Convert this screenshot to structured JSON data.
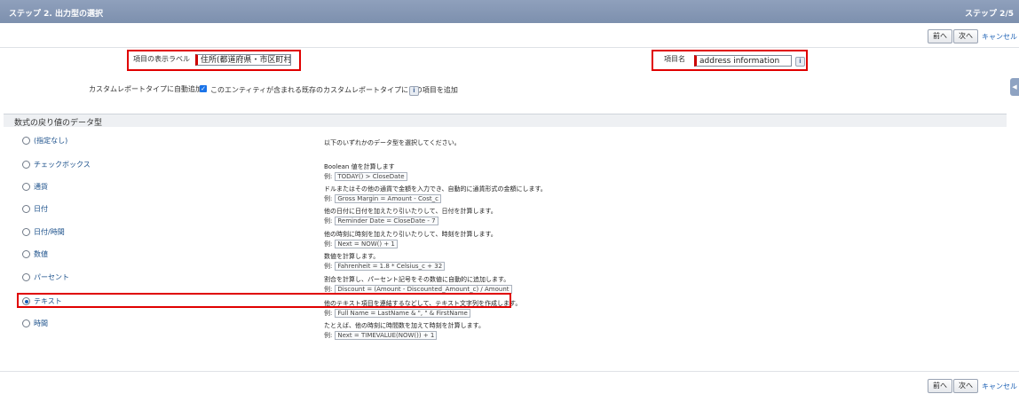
{
  "header": {
    "title": "ステップ 2. 出力型の選択",
    "step": "ステップ 2/5"
  },
  "nav": {
    "prev": "前へ",
    "next": "次へ",
    "cancel": "キャンセル"
  },
  "form": {
    "field_label_caption": "項目の表示ラベル",
    "field_label_value": "住所(都道府県・市区町村",
    "field_name_caption": "項目名",
    "field_name_value": "address information",
    "auto_add_caption": "カスタムレポートタイプに自動追加",
    "auto_add_text": "このエンティティが含まれる既存のカスタムレポートタイプにこの項目を追加"
  },
  "section_title": "数式の戻り値のデータ型",
  "types": [
    {
      "label": "(指定なし)",
      "desc": "以下のいずれかのデータ型を選択してください。",
      "example": ""
    },
    {
      "label": "チェックボックス",
      "desc": "Boolean 値を計算します",
      "example": "TODAY() > CloseDate"
    },
    {
      "label": "通貨",
      "desc": "ドルまたはその他の通貨で金額を入力でき、自動的に通貨形式の金額にします。",
      "example": "Gross Margin = Amount - Cost_c"
    },
    {
      "label": "日付",
      "desc": "他の日付に日付を加えたり引いたりして、日付を計算します。",
      "example": "Reminder Date = CloseDate - 7"
    },
    {
      "label": "日付/時間",
      "desc": "他の時刻に時刻を加えたり引いたりして、時刻を計算します。",
      "example": "Next = NOW() + 1"
    },
    {
      "label": "数値",
      "desc": "数値を計算します。",
      "example": "Fahrenheit = 1.8 * Celsius_c + 32"
    },
    {
      "label": "パーセント",
      "desc": "割合を計算し、パーセント記号をその数値に自動的に追加します。",
      "example": "Discount = (Amount - Discounted_Amount_c) / Amount"
    },
    {
      "label": "テキスト",
      "desc": "他のテキスト項目を連結するなどして、テキスト文字列を作成します。",
      "example": "Full Name = LastName & \", \" & FirstName"
    },
    {
      "label": "時間",
      "desc": "たとえば、他の時刻に時間数を加えて時刻を計算します。",
      "example": "Next = TIMEVALUE(NOW()) + 1"
    }
  ],
  "example_prefix": "例:",
  "icons": {
    "info": "i",
    "check": "✓",
    "side": "◀"
  },
  "colors": {
    "highlight": "#e00000",
    "header": "#8a9bb8",
    "link": "#1a5fb4"
  }
}
